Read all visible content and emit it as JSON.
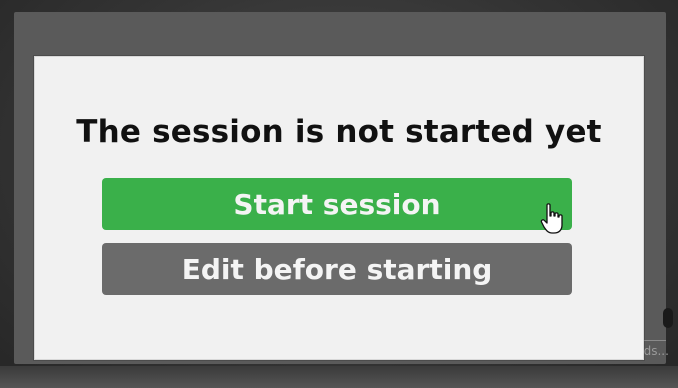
{
  "dialog": {
    "title": "The session is not started yet",
    "start_button_label": "Start session",
    "edit_button_label": "Edit before starting"
  },
  "background": {
    "corner_text": "nds..."
  },
  "colors": {
    "start_button": "#3ab04a",
    "edit_button": "#6b6b6b",
    "dialog_background": "#f1f1f1",
    "title_text": "#111111"
  },
  "icons": {
    "cursor": "hand-pointer-icon"
  }
}
